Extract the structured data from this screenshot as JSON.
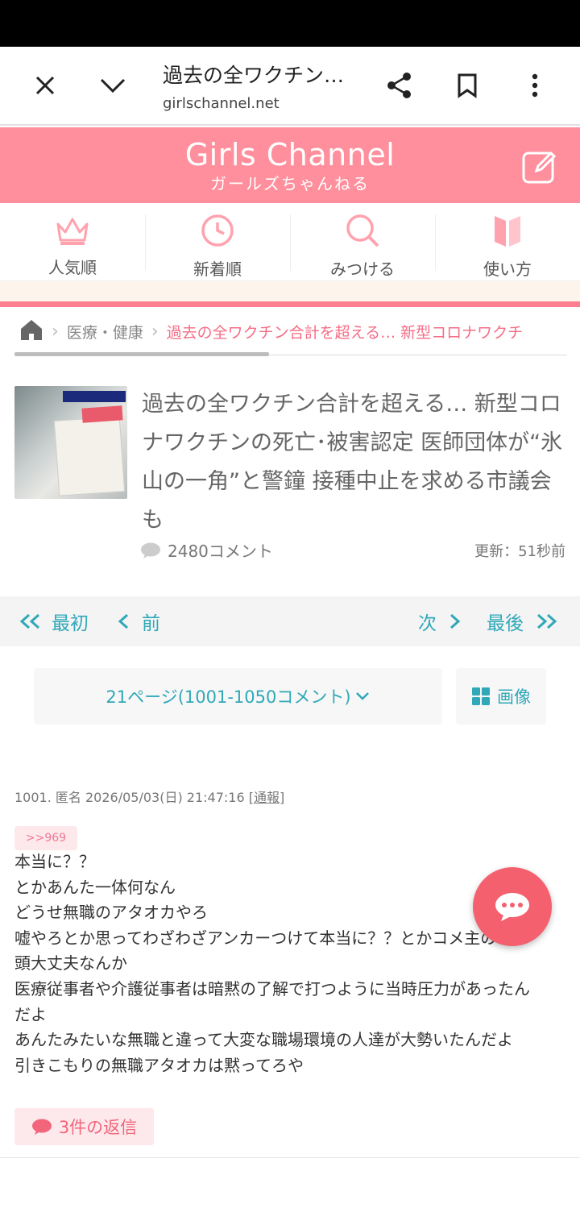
{
  "browser": {
    "title": "過去の全ワクチン…",
    "url": "girlschannel.net"
  },
  "site": {
    "logo": "Girls Channel",
    "logo_sub": "ガールズちゃんねる",
    "brand_color": "#ff8f9c"
  },
  "nav": {
    "tabs": [
      {
        "label": "人気順",
        "icon": "crown-icon"
      },
      {
        "label": "新着順",
        "icon": "clock-icon"
      },
      {
        "label": "みつける",
        "icon": "search-icon"
      },
      {
        "label": "使い方",
        "icon": "book-icon"
      }
    ]
  },
  "breadcrumb": {
    "category": "医療・健康",
    "current": "過去の全ワクチン合計を超える… 新型コロナワクチ"
  },
  "article": {
    "title": "過去の全ワクチン合計を超える… 新型コロナワクチンの死亡･被害認定 医師団体が“氷山の一角”と警鐘 接種中止を求める市議会も",
    "comments": "2480コメント",
    "updated": "更新：51秒前"
  },
  "pager": {
    "first": "最初",
    "prev": "前",
    "next": "次",
    "last": "最後",
    "page_select": "21ページ(1001-1050コメント)",
    "images": "画像"
  },
  "comment": {
    "meta": "1001. 匿名 2026/05/03(日) 21:47:16",
    "report": "通報",
    "anchor": ">>969",
    "lines": [
      "本当に？？",
      "とかあんた一体何なん",
      "どうせ無職のアタオカやろ",
      "嘘やろとか思ってわざわざアンカーつけて本当に？？とかコメ主の",
      "頭大丈夫なんか",
      "医療従事者や介護従事者は暗黙の了解で打つように当時圧力があったん",
      "だよ",
      "あんたみたいな無職と違って大変な職場環境の人達が大勢いたんだよ",
      "引きこもりの無職アタオカは黙ってろや"
    ],
    "replies": "3件の返信"
  }
}
